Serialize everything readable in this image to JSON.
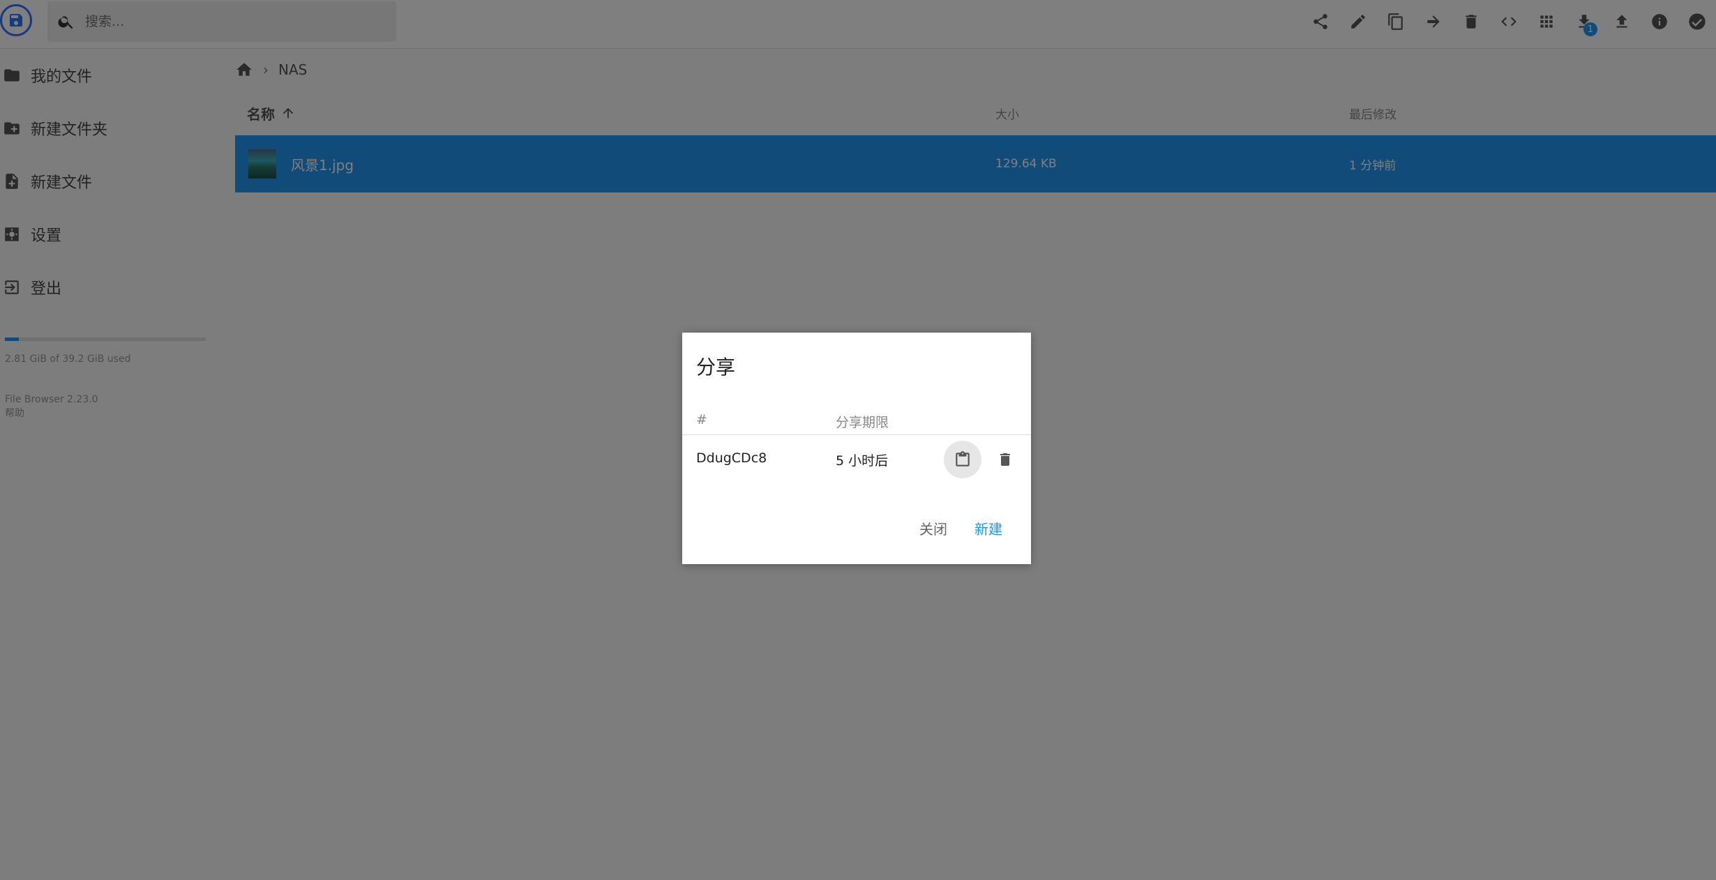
{
  "header": {
    "search_placeholder": "搜索...",
    "download_badge": "1",
    "toolbar_icons": [
      "share-icon",
      "edit-icon",
      "copy-icon",
      "move-icon",
      "delete-icon",
      "code-icon",
      "grid-icon",
      "download-icon",
      "upload-icon",
      "info-icon",
      "check-icon"
    ]
  },
  "sidebar": {
    "items": [
      {
        "label": "我的文件",
        "icon": "folder-icon"
      },
      {
        "label": "新建文件夹",
        "icon": "new-folder-icon"
      },
      {
        "label": "新建文件",
        "icon": "new-file-icon"
      },
      {
        "label": "设置",
        "icon": "settings-icon"
      },
      {
        "label": "登出",
        "icon": "logout-icon"
      }
    ],
    "quota_fraction": 0.07,
    "quota_text": "2.81 GiB of 39.2 GiB used",
    "version": "File Browser 2.23.0",
    "help": "帮助"
  },
  "breadcrumb": {
    "current": "NAS"
  },
  "list": {
    "columns": {
      "name": "名称",
      "size": "大小",
      "modified": "最后修改"
    },
    "rows": [
      {
        "name": "风景1.jpg",
        "size": "129.64 KB",
        "modified": "1 分钟前"
      }
    ]
  },
  "dialog": {
    "title": "分享",
    "col_hash": "#",
    "col_expire": "分享期限",
    "share": {
      "id": "DdugCDc8",
      "expire": "5 小时后"
    },
    "close_label": "关闭",
    "new_label": "新建"
  },
  "colors": {
    "accent": "#2196f3",
    "logo_ring": "#2979ff"
  }
}
